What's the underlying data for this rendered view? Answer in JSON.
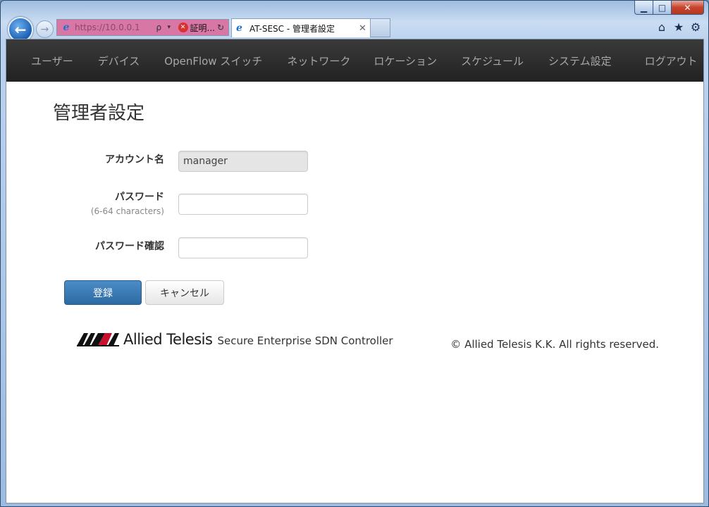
{
  "browser": {
    "address_url": "https://10.0.0.1",
    "cert_label": "証明...",
    "tab_title": "AT-SESC - 管理者設定",
    "caption": {
      "min": "▁",
      "max": "□",
      "close": "✕"
    },
    "icons": {
      "back": "←",
      "forward": "→",
      "search": "ρ",
      "dropdown": "▾",
      "error": "✕",
      "refresh": "↻",
      "tab_close": "✕",
      "home": "⌂",
      "favorites": "★",
      "tools": "⚙",
      "ie": "e"
    }
  },
  "navbar": {
    "items": [
      {
        "label": "ユーザー"
      },
      {
        "label": "デバイス"
      },
      {
        "label": "OpenFlow スイッチ"
      },
      {
        "label": "ネットワーク"
      },
      {
        "label": "ロケーション"
      },
      {
        "label": "スケジュール"
      },
      {
        "label": "システム設定"
      },
      {
        "label": "ログアウト"
      }
    ]
  },
  "page": {
    "title": "管理者設定"
  },
  "form": {
    "account_label": "アカウント名",
    "account_value": "manager",
    "password_label": "パスワード",
    "password_hint": "(6-64 characters)",
    "password_value": "",
    "confirm_label": "パスワード確認",
    "confirm_value": ""
  },
  "buttons": {
    "submit": "登録",
    "cancel": "キャンセル"
  },
  "footer": {
    "brand": "Allied Telesis",
    "product": "Secure Enterprise SDN Controller",
    "copyright": "© Allied Telesis K.K. All rights reserved."
  }
}
